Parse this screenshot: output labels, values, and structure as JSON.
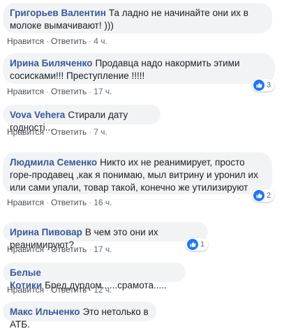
{
  "ui": {
    "like": "Нравится",
    "reply": "Ответить",
    "dot": "·"
  },
  "comments": [
    {
      "author": "Григорьев Валентин",
      "text": "Та ладно не начинайте они их в молоке вымачивают! )))",
      "time": "4 ч."
    },
    {
      "author": "Ирина Биляченко",
      "text": "Продавца надо накормить этими сосисками!!! Преступление !!!!!",
      "time": "17 ч.",
      "reactions": "3"
    },
    {
      "author": "Vova Vehera",
      "text": "Стирали дату годності...",
      "time": "7 ч."
    },
    {
      "author": "Людмила Семенко",
      "text": "Никто их не реанимирует, просто горе-продавец ,как я понимаю, мыл витрину и уронил их или сами упали, товар такой, конечно же утилизируют",
      "time": "16 ч.",
      "reactions": "2"
    },
    {
      "author": "Ирина Пивовар",
      "text": "В чем это они их реанимируют?",
      "time": "17 ч.",
      "reactions": "1"
    },
    {
      "author": "Белые Котики",
      "text": "Бред,дурдом......срамота.....",
      "time": "12 ч."
    },
    {
      "author": "Макс Ильченко",
      "text": "Это нетолько в АТБ."
    }
  ],
  "colors": {
    "bubble": "#f2f3f5",
    "author": "#385898",
    "like_blue": "#2078f4"
  }
}
